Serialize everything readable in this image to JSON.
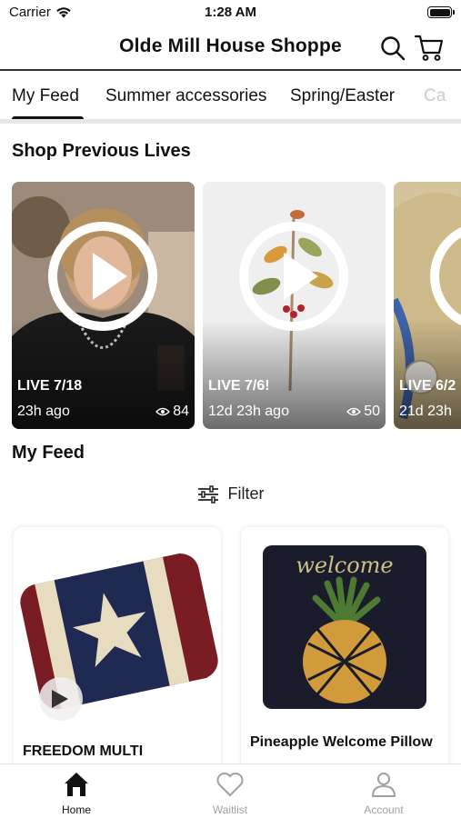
{
  "status_bar": {
    "carrier": "Carrier",
    "time": "1:28 AM"
  },
  "header": {
    "title": "Olde Mill House Shoppe",
    "search_icon": "search-icon",
    "cart_icon": "cart-icon"
  },
  "tabs": [
    {
      "label": "My Feed",
      "active": true
    },
    {
      "label": "Summer accessories",
      "active": false
    },
    {
      "label": "Spring/Easter",
      "active": false
    },
    {
      "label": "Ca",
      "active": false
    }
  ],
  "previous_lives": {
    "title": "Shop Previous Lives",
    "items": [
      {
        "label": "LIVE 7/18",
        "ago": "23h ago",
        "views": "84"
      },
      {
        "label": "LIVE 7/6!",
        "ago": "12d 23h ago",
        "views": "50"
      },
      {
        "label": "LIVE 6/2",
        "ago": "21d 23h",
        "views": ""
      }
    ]
  },
  "feed": {
    "title": "My Feed",
    "filter_label": "Filter",
    "products": [
      {
        "name": "FREEDOM MULTI",
        "has_video": true
      },
      {
        "name": "Pineapple Welcome Pillow",
        "has_video": false
      }
    ],
    "pillow_text": "welcome"
  },
  "bottom_nav": [
    {
      "label": "Home",
      "icon": "home-icon",
      "active": true
    },
    {
      "label": "Waitlist",
      "icon": "heart-icon",
      "active": false
    },
    {
      "label": "Account",
      "icon": "person-icon",
      "active": false
    }
  ]
}
